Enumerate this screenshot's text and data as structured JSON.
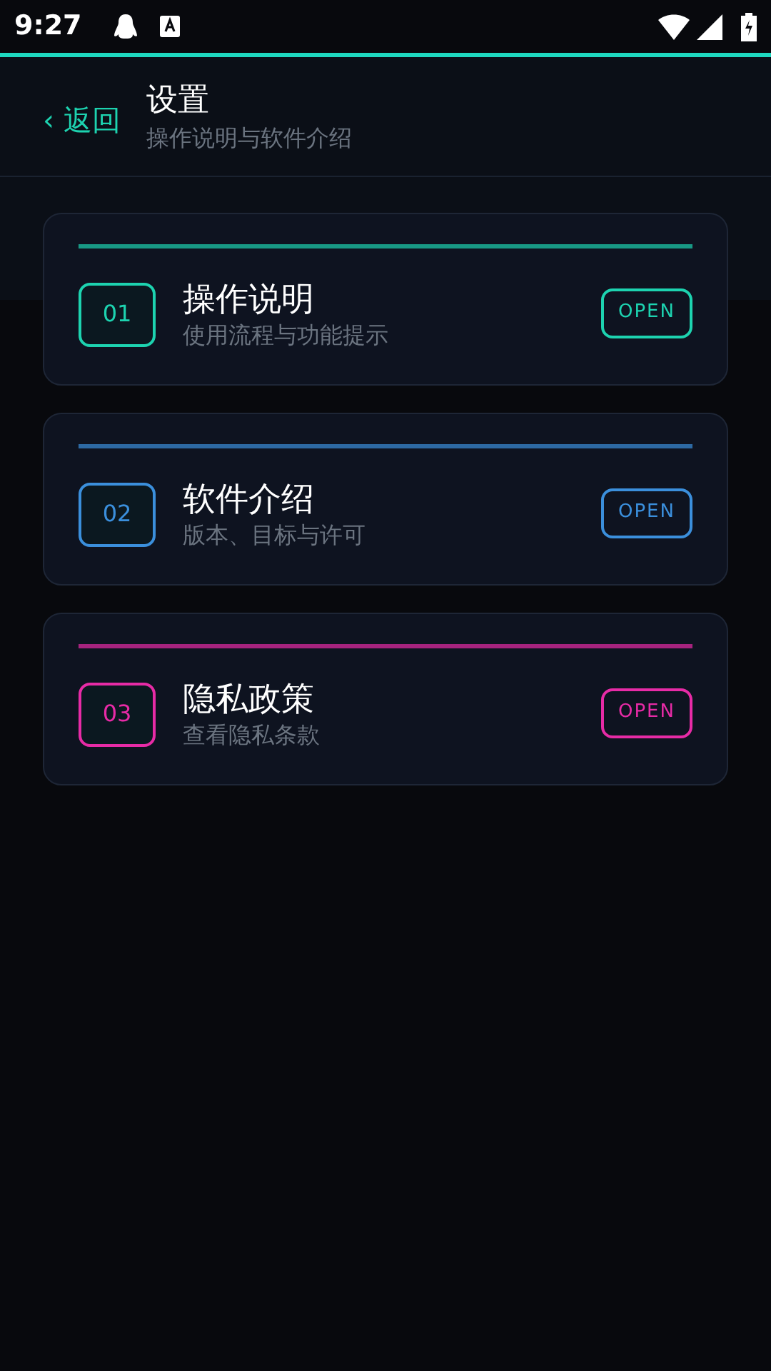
{
  "status_bar": {
    "time": "9:27"
  },
  "header": {
    "back": "‹ 返回",
    "title": "设置",
    "subtitle": "操作说明与软件介绍"
  },
  "cards": [
    {
      "number": "01",
      "title": "操作说明",
      "subtitle": "使用流程与功能提示",
      "button": "OPEN",
      "color": "#1dd3b0"
    },
    {
      "number": "02",
      "title": "软件介绍",
      "subtitle": "版本、目标与许可",
      "button": "OPEN",
      "color": "#3b8fdc"
    },
    {
      "number": "03",
      "title": "隐私政策",
      "subtitle": "查看隐私条款",
      "button": "OPEN",
      "color": "#e72ba6"
    }
  ]
}
